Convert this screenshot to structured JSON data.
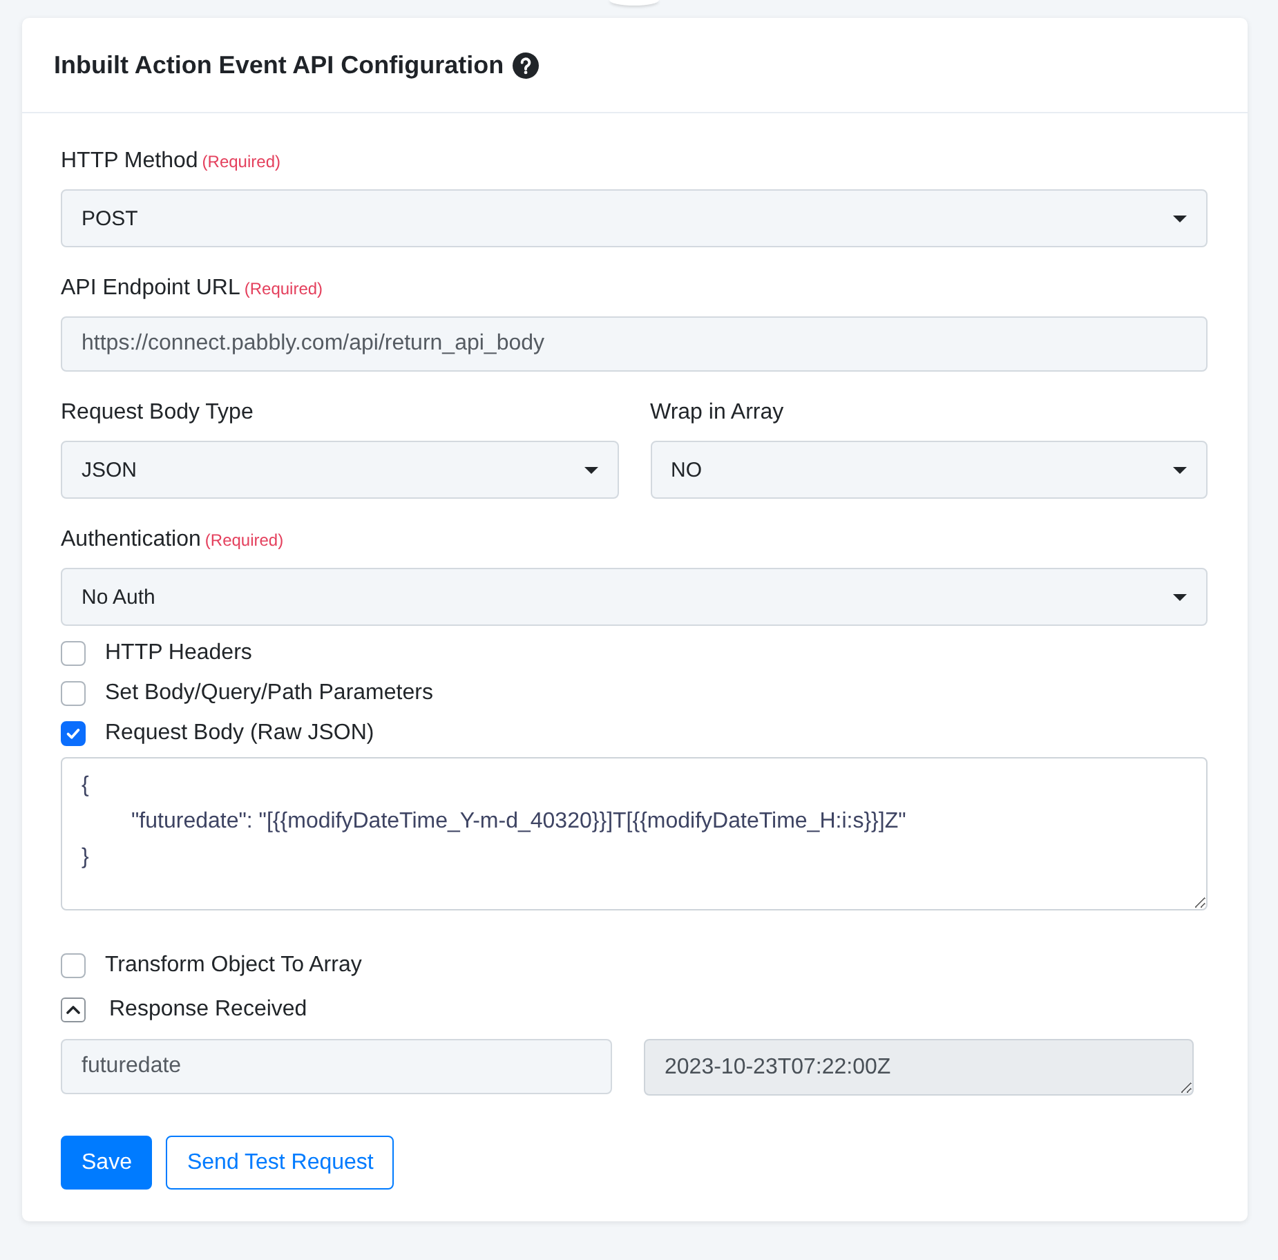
{
  "header": {
    "title": "Inbuilt Action Event API Configuration"
  },
  "form": {
    "items": [
      {
        "kind": "select",
        "label": "HTTP Method",
        "note": "(Required)",
        "value": "POST"
      },
      {
        "kind": "input",
        "label": "API Endpoint URL",
        "note": "(Required)",
        "value": "https://connect.pabbly.com/api/return_api_body"
      },
      {
        "kind": "columns",
        "fields": [
          {
            "kind": "select",
            "label": "Request Body Type",
            "value": "JSON"
          },
          {
            "kind": "select",
            "label": "Wrap in Array",
            "value": "NO"
          }
        ]
      },
      {
        "kind": "select",
        "label": "Authentication",
        "note": "(Required)",
        "value": "No Auth"
      },
      {
        "kind": "checkbox",
        "label": "HTTP Headers",
        "checked": false
      },
      {
        "kind": "checkbox",
        "label": "Set Body/Query/Path Parameters",
        "checked": false
      },
      {
        "kind": "checkbox",
        "label": "Request Body (Raw JSON)",
        "checked": true
      },
      {
        "kind": "code",
        "value": "{\n\t\"futuredate\": \"[{{modifyDateTime_Y-m-d_40320}}]T[{{modifyDateTime_H:i:s}}]Z\"\n}"
      },
      {
        "kind": "checkbox",
        "label": "Transform Object To Array",
        "checked": false
      },
      {
        "kind": "toggle",
        "label": "Response Received",
        "expanded": true
      },
      {
        "kind": "response",
        "key": "futuredate",
        "value": "2023-10-23T07:22:00Z"
      }
    ]
  },
  "buttons": [
    {
      "label": "Save",
      "kind": "primary"
    },
    {
      "label": "Send Test Request",
      "kind": "outline"
    }
  ]
}
